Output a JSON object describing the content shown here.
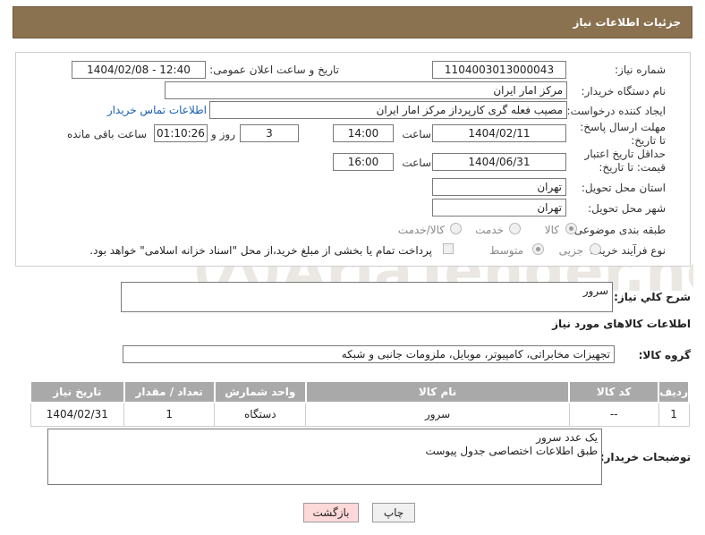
{
  "header": {
    "title": "جزئیات اطلاعات نیاز"
  },
  "form": {
    "need_number_label": "شماره نیاز:",
    "need_number": "1104003013000043",
    "announce_label": "تاریخ و ساعت اعلان عمومی:",
    "announce_value": "1404/02/08 - 12:40",
    "buyer_org_label": "نام دستگاه خریدار:",
    "buyer_org": "مرکز امار ایران",
    "creator_label": "ایجاد کننده درخواست:",
    "creator": "مصیب فعله گری کارپرداز مرکز امار ایران",
    "contact_link": "اطلاعات تماس خریدار",
    "reply_deadline_label": "مهلت ارسال پاسخ: تا تاریخ:",
    "reply_date": "1404/02/11",
    "time_label": "ساعت",
    "reply_time": "14:00",
    "days_value": "3",
    "days_label": "روز و",
    "remaining_time": "01:10:26",
    "remaining_label": "ساعت باقی مانده",
    "price_validity_label": "حداقل تاریخ اعتبار قیمت: تا تاریخ:",
    "price_date": "1404/06/31",
    "price_time_label": "ساعت",
    "price_time": "16:00",
    "province_label": "استان محل تحویل:",
    "province": "تهران",
    "city_label": "شهر محل تحویل:",
    "city": "تهران",
    "category_label": "طبقه بندی موضوعی:",
    "category_options": [
      "کالا",
      "خدمت",
      "کالا/خدمت"
    ],
    "process_label": "نوع فرآیند خرید :",
    "process_options": [
      "جزیی",
      "متوسط"
    ],
    "payment_note": "پرداخت تمام یا بخشی از مبلغ خرید،از محل \"اسناد خزانه اسلامی\" خواهد بود."
  },
  "summary": {
    "label": "شرح کلي نياز:",
    "value": "سرور"
  },
  "goods_section": {
    "title": "اطلاعات کالاهای مورد نیاز",
    "group_label": "گروه کالا:",
    "group_value": "تجهیزات مخابراتی، کامپیوتر، موبایل، ملزومات جانبی و شبکه"
  },
  "table": {
    "headers": [
      "ردیف",
      "کد کالا",
      "نام کالا",
      "واحد شمارش",
      "تعداد / مقدار",
      "تاریخ نیاز"
    ],
    "rows": [
      [
        "1",
        "--",
        "سرور",
        "دستگاه",
        "1",
        "1404/02/31"
      ]
    ]
  },
  "buyer_notes": {
    "label": "توضیحات خریدار:",
    "value": "یک عدد سرور\nطبق اطلاعات اختصاصی جدول پیوست"
  },
  "buttons": {
    "print": "چاپ",
    "back": "بازگشت"
  },
  "watermark": {
    "text": "AriaTender.neT"
  },
  "colors": {
    "header_bg": "#8a7150",
    "table_header_bg": "#a9a9a9",
    "link": "#1a5fb4",
    "back_button_bg": "#ffd9d9"
  }
}
